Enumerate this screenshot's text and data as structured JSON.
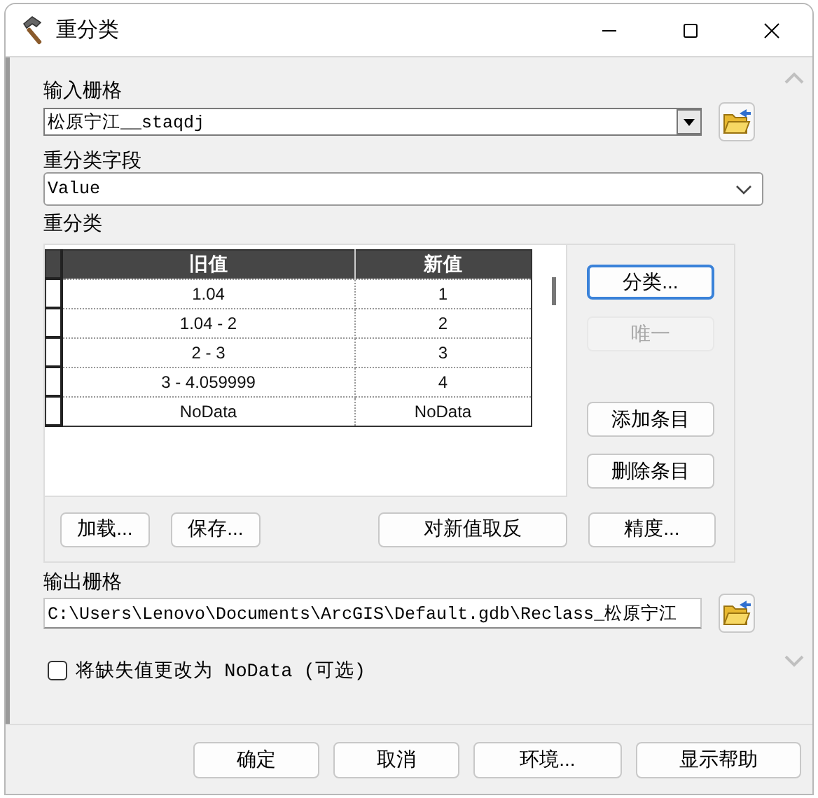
{
  "window": {
    "title": "重分类"
  },
  "input_raster": {
    "label": "输入栅格",
    "value": "松原宁江__staqdj"
  },
  "reclass_field": {
    "label": "重分类字段",
    "value": "Value"
  },
  "reclassification": {
    "label": "重分类",
    "columns": [
      "旧值",
      "新值"
    ],
    "rows": [
      {
        "old": "1.04",
        "new": "1"
      },
      {
        "old": "1.04 - 2",
        "new": "2"
      },
      {
        "old": "2 - 3",
        "new": "3"
      },
      {
        "old": "3 - 4.059999",
        "new": "4"
      },
      {
        "old": "NoData",
        "new": "NoData"
      }
    ],
    "side_buttons": [
      {
        "label": "分类...",
        "disabled": false,
        "focused": true
      },
      {
        "label": "唯一",
        "disabled": true,
        "focused": false
      },
      {
        "label": "添加条目",
        "disabled": false,
        "focused": false
      },
      {
        "label": "删除条目",
        "disabled": false,
        "focused": false
      }
    ],
    "bottom_buttons": [
      {
        "label": "加载..."
      },
      {
        "label": "保存..."
      },
      {
        "label": "对新值取反"
      },
      {
        "label": "精度..."
      }
    ]
  },
  "output_raster": {
    "label": "输出栅格",
    "value": "C:\\Users\\Lenovo\\Documents\\ArcGIS\\Default.gdb\\Reclass_松原宁江"
  },
  "missing_to_nodata": {
    "label": "将缺失值更改为 NoData (可选)",
    "checked": false
  },
  "buttons": [
    {
      "label": "确定"
    },
    {
      "label": "取消"
    },
    {
      "label": "环境..."
    },
    {
      "label": "显示帮助"
    }
  ]
}
